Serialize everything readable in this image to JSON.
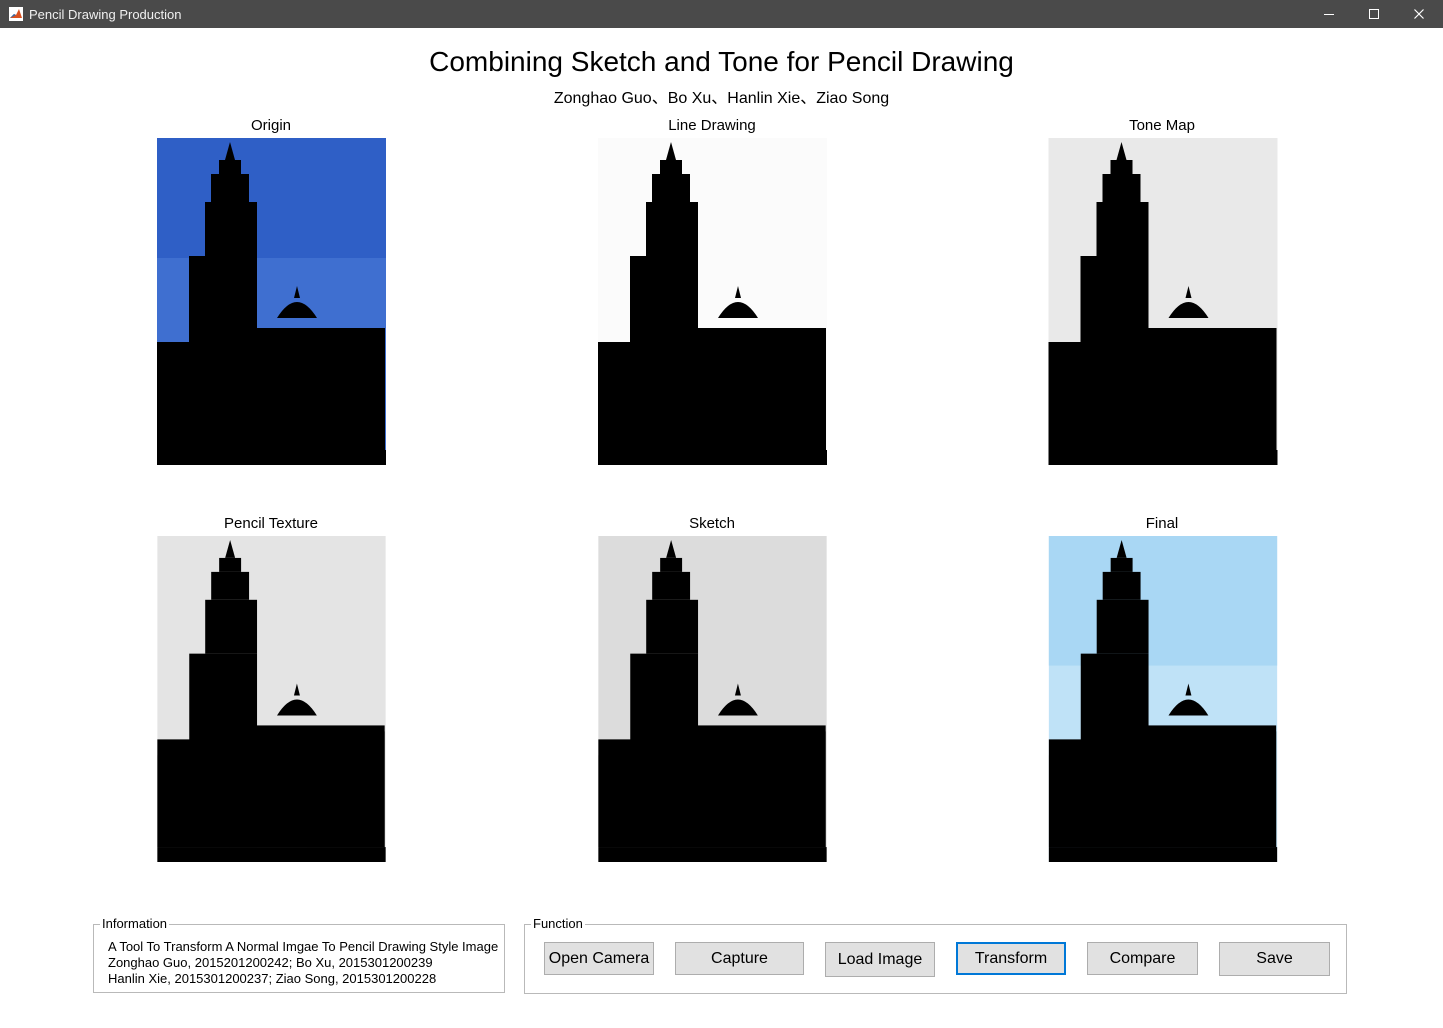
{
  "window": {
    "title": "Pencil Drawing Production",
    "controls": {
      "minimize_icon": "minimize-icon",
      "maximize_icon": "maximize-icon",
      "close_icon": "close-icon"
    }
  },
  "header": {
    "title": "Combining Sketch and Tone for Pencil Drawing",
    "authors": "Zonghao Guo、Bo Xu、Hanlin Xie、Ziao Song"
  },
  "panels": [
    {
      "label": "Origin"
    },
    {
      "label": "Line Drawing"
    },
    {
      "label": "Tone Map"
    },
    {
      "label": "Pencil Texture"
    },
    {
      "label": "Sketch"
    },
    {
      "label": "Final"
    }
  ],
  "information": {
    "legend": "Information",
    "lines": [
      "A Tool To Transform A Normal Imgae  To Pencil Drawing Style Image",
      "Zonghao Guo, 2015201200242; Bo Xu, 2015301200239",
      "Hanlin Xie, 2015301200237; Ziao Song, 2015301200228"
    ]
  },
  "function": {
    "legend": "Function",
    "buttons": [
      {
        "label": "Open Camera"
      },
      {
        "label": "Capture"
      },
      {
        "label": "Load Image"
      },
      {
        "label": "Transform"
      },
      {
        "label": "Compare"
      },
      {
        "label": "Save"
      }
    ]
  },
  "colors": {
    "titlebar": "#4a4a4a",
    "sky": "#3f6fd0",
    "brick": "#a9492a",
    "button_face": "#e1e1e1",
    "focus_border": "#0078d7"
  }
}
